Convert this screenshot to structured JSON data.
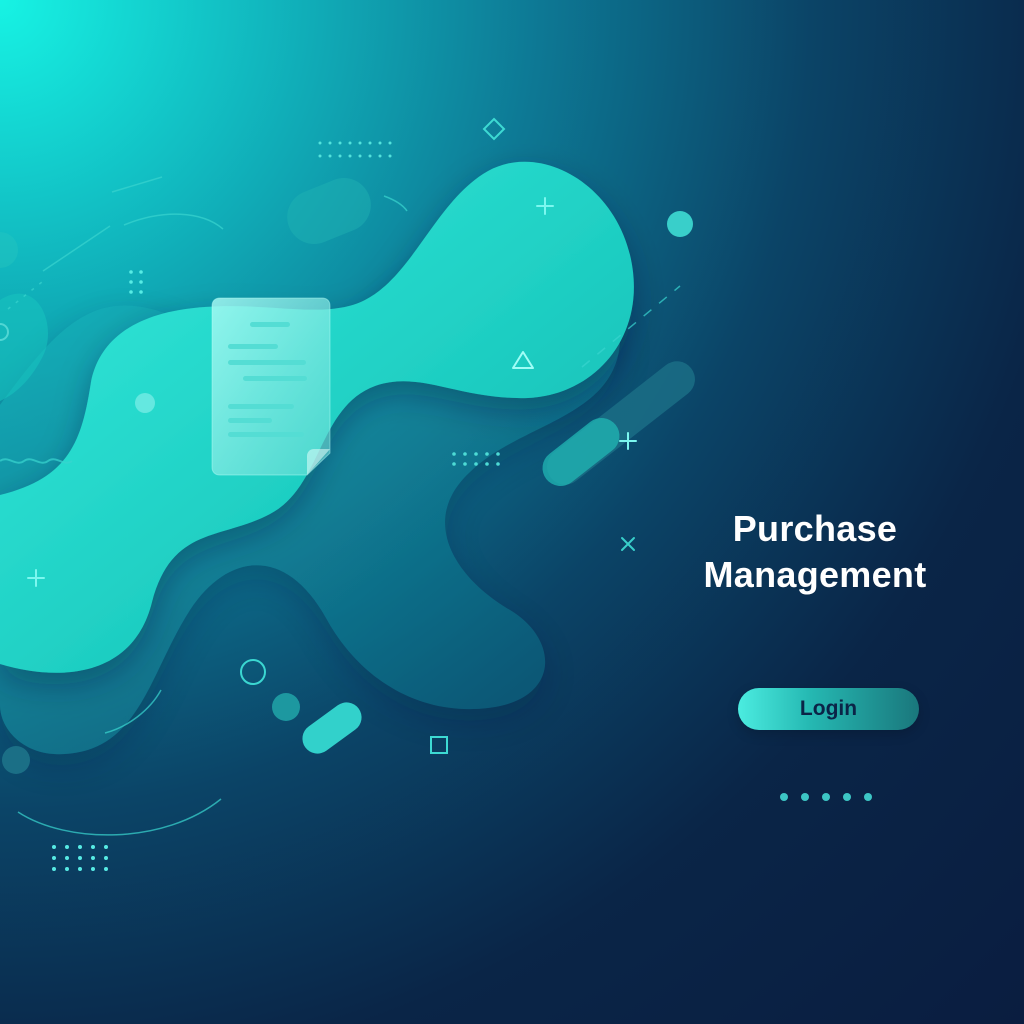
{
  "screen": {
    "title": "Purchase Management",
    "login_label": "Login",
    "theme": {
      "background_dark": "#0a1d40",
      "accent": "#17f3e4",
      "button_gradient_start": "#4bece0",
      "button_gradient_end": "#1a777c"
    },
    "decorations": {
      "document_icon": "document-icon",
      "pager_dots": 5
    }
  }
}
